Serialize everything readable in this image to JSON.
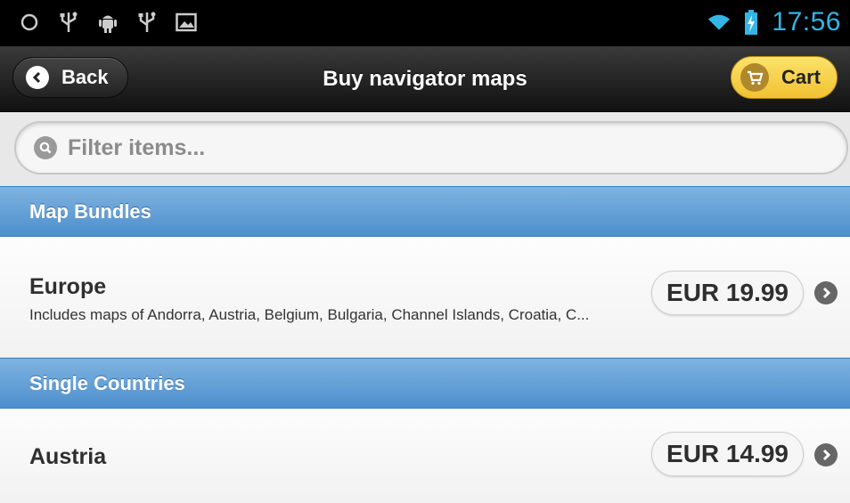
{
  "status_bar": {
    "time": "17:56",
    "left_icons": [
      "circle-icon",
      "usb-icon",
      "android-icon",
      "usb-icon",
      "image-icon"
    ],
    "right_icons": [
      "wifi-icon",
      "battery-charging-icon"
    ]
  },
  "header": {
    "back_label": "Back",
    "title": "Buy navigator maps",
    "cart_label": "Cart"
  },
  "filter": {
    "placeholder": "Filter items..."
  },
  "sections": [
    {
      "title": "Map Bundles",
      "items": [
        {
          "title": "Europe",
          "description": "Includes maps of Andorra, Austria, Belgium, Bulgaria, Channel Islands, Croatia, C...",
          "price": "EUR 19.99"
        }
      ]
    },
    {
      "title": "Single Countries",
      "items": [
        {
          "title": "Austria",
          "price": "EUR 14.99"
        }
      ]
    }
  ],
  "colors": {
    "divider": "#5b9bd5",
    "cart_button": "#f5cf45",
    "time": "#33b5e5"
  }
}
